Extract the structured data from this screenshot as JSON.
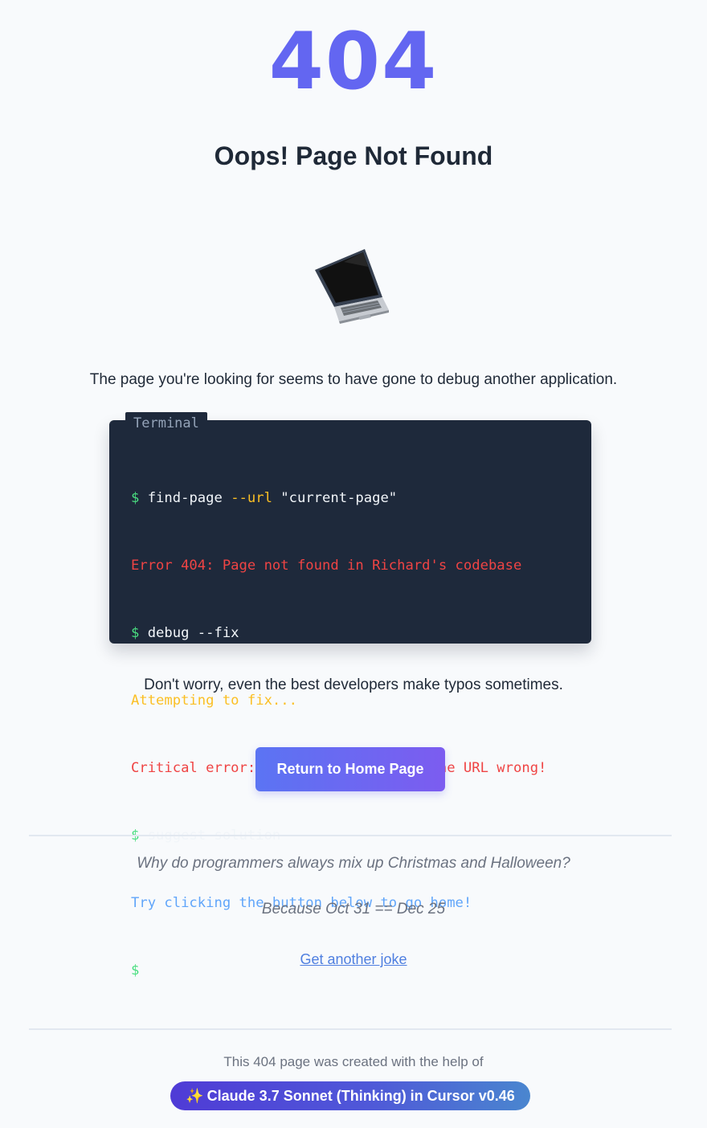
{
  "hero": {
    "code": "404",
    "title": "Oops! Page Not Found",
    "illustration_icon": "laptop-icon"
  },
  "lead_text": "The page you're looking for seems to have gone to debug another application.",
  "terminal": {
    "tab_label": "Terminal",
    "lines": [
      {
        "prompt": "$",
        "command": " find-page ",
        "flag": "--url",
        "argument": " \"current-page\""
      },
      {
        "text": "Error 404: Page not found in Richard's codebase",
        "kind": "error"
      },
      {
        "prompt": "$",
        "command": " debug --fix"
      },
      {
        "text": "Attempting to fix...",
        "kind": "warning"
      },
      {
        "text": "Critical error: User probably typed the URL wrong!",
        "kind": "error"
      },
      {
        "prompt": "$",
        "command": " suggest-solution"
      },
      {
        "text": "Try clicking the button below to go home!",
        "kind": "info"
      },
      {
        "prompt": "$"
      }
    ]
  },
  "reassurance": "Don't worry, even the best developers make typos sometimes.",
  "home_button_label": "Return to Home Page",
  "joke": {
    "question": "Why do programmers always mix up Christmas and Halloween?",
    "answer": "Because Oct 31 == Dec 25",
    "another_label": "Get another joke"
  },
  "footer": {
    "credit_text": "This 404 page was created with the help of",
    "badge_icon": "sparkles-icon",
    "badge_label": "Claude 3.7 Sonnet (Thinking) in Cursor v0.46"
  },
  "colors": {
    "accent": "#6366f1",
    "background": "#f8fafc",
    "terminal_bg": "#1e293b",
    "prompt": "#4ade80",
    "error": "#ef4444",
    "warning": "#fbbf24",
    "info": "#60a5fa"
  }
}
